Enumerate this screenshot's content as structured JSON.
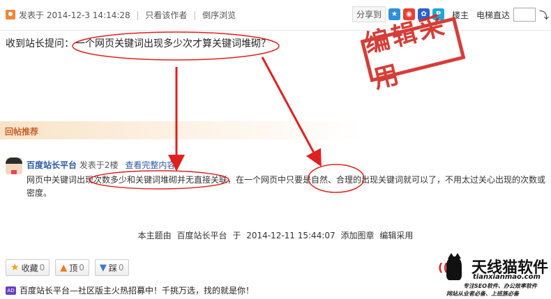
{
  "post_header": {
    "posted_label": "发表于",
    "posted_time": "2014-12-3 14:14:28",
    "only_author": "只看该作者",
    "reverse_browse": "倒序浏览"
  },
  "share": {
    "label": "分享到",
    "icons": [
      "qzone-icon",
      "weibo-icon",
      "baidu-icon",
      "tencent-weibo-icon"
    ]
  },
  "floor": "楼主",
  "jump_label": "电梯直达",
  "jump_value": "",
  "question": {
    "prefix": "收到站长提问：",
    "body": "一个网页关键词出现多少次才算关键词堆砌？"
  },
  "stamp": "编辑采用",
  "recommend_label": "回帖推荐",
  "reply": {
    "author": "百度站长平台",
    "meta": "发表于2楼",
    "full_link": "查看完整内容",
    "body": "网页中关键词出现次数多少和关键词堆砌并无直接关联，在一个网页中只要是自然、合理的出现关键词就可以了，不用太过关心出现的次数或密度。"
  },
  "topic_info": {
    "prefix": "本主题由",
    "author": "百度站长平台",
    "at": "于",
    "time": "2014-12-11 15:44:07",
    "action": "添加图章",
    "stamp_name": "编辑采用"
  },
  "actions": [
    {
      "label": "收藏",
      "count": "0"
    },
    {
      "label": "顶",
      "count": "0"
    },
    {
      "label": "踩",
      "count": "0"
    }
  ],
  "ad": {
    "badge": "AD",
    "text": "百度站长平台—社区版主火热招募中！千挑万选，找的就是你！"
  },
  "brand": {
    "name": "天线猫软件",
    "domain": "tianxianmao.com",
    "tagline1": "专注SEO软件、办公效率软件",
    "tagline2": "网站从业者必备、上班族必备"
  },
  "colors": {
    "stamp_red": "#d12a23",
    "annotation_red": "#e02020",
    "link_blue": "#2a5aa8",
    "recommend_orange": "#c6622a"
  }
}
